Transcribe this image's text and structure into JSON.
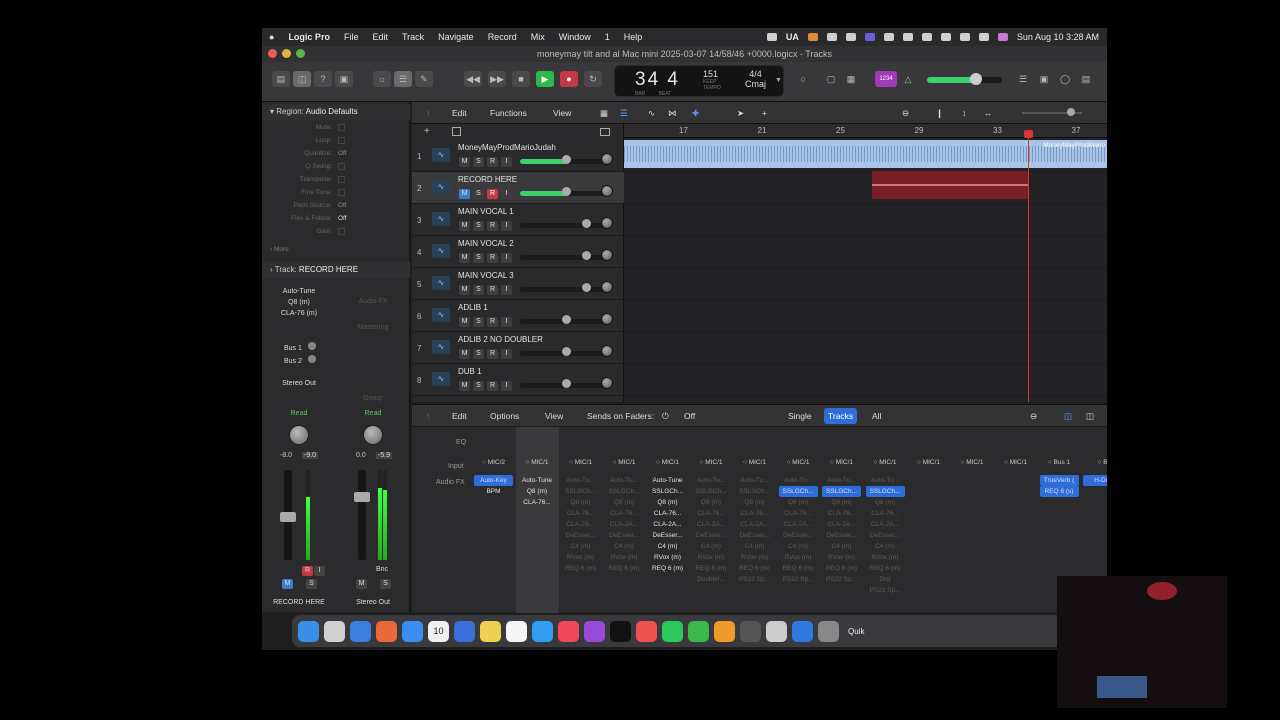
{
  "menubar": {
    "app": "Logic Pro",
    "items": [
      "File",
      "Edit",
      "Track",
      "Navigate",
      "Record",
      "Mix",
      "Window",
      "1",
      "Help"
    ],
    "ua_label": "UA",
    "datetime": "Sun Aug 10  3:28 AM"
  },
  "window_title": "moneymay tilt and al Mac mini 2025-03-07 14/58/46 +0000.logicx - Tracks",
  "lcd": {
    "bar": "34",
    "beat": "4",
    "bar_label": "BAR",
    "beat_label": "BEAT",
    "tempo": "151",
    "tempo_mode": "KEEP",
    "tempo_label": "TEMPO",
    "time_sig": "4/4",
    "key": "Cmaj"
  },
  "toolbar_badge": "1234",
  "inspector": {
    "region_header": "Region:",
    "region_name": "Audio Defaults",
    "params": [
      {
        "label": "Mute:",
        "value": ""
      },
      {
        "label": "Loop:",
        "value": ""
      },
      {
        "label": "Quantize:",
        "value": "Off"
      },
      {
        "label": "Q-Swing:",
        "value": ""
      },
      {
        "label": "Transpose:",
        "value": ""
      },
      {
        "label": "Fine Tune:",
        "value": ""
      },
      {
        "label": "Pitch Source:",
        "value": "Off"
      },
      {
        "label": "Flex & Follow:",
        "value": "Off"
      },
      {
        "label": "Gain:",
        "value": ""
      }
    ],
    "more_label": "More",
    "track_header": "Track:",
    "track_name": "RECORD HERE",
    "strip1": {
      "plugins": [
        "Auto-Tune",
        "Q8 (m)",
        "CLA-76 (m)"
      ],
      "sends": [
        "Bus 1",
        "Bus 2"
      ],
      "output": "Stereo Out",
      "automation": "Read",
      "pan": "-8.0",
      "gain": "-9.0",
      "name": "RECORD HERE"
    },
    "strip2": {
      "fx": "Audio FX",
      "mastering": "Mastering",
      "group": "Group",
      "automation": "Read",
      "pan": "0.0",
      "gain": "-5.9",
      "bnc": "Bnc",
      "name": "Stereo Out"
    }
  },
  "arrange": {
    "toolbar": {
      "edit": "Edit",
      "functions": "Functions",
      "view": "View"
    },
    "ruler": [
      "17",
      "21",
      "25",
      "29",
      "33",
      "37"
    ],
    "tracks": [
      {
        "num": "1",
        "name": "MoneyMayProdMarioJudah",
        "rec": false
      },
      {
        "num": "2",
        "name": "RECORD HERE",
        "rec": true
      },
      {
        "num": "3",
        "name": "MAIN VOCAL 1",
        "rec": false
      },
      {
        "num": "4",
        "name": "MAIN VOCAL 2",
        "rec": false
      },
      {
        "num": "5",
        "name": "MAIN VOCAL 3",
        "rec": false
      },
      {
        "num": "6",
        "name": "ADLIB 1",
        "rec": false
      },
      {
        "num": "7",
        "name": "ADLIB 2 NO DOUBLER",
        "rec": false
      },
      {
        "num": "8",
        "name": "DUB 1",
        "rec": false
      }
    ],
    "region1_name": "MoneyMayProdMario"
  },
  "mixer": {
    "toolbar": {
      "edit": "Edit",
      "options": "Options",
      "view": "View",
      "sends_label": "Sends on Faders:",
      "sends_value": "Off",
      "single": "Single",
      "tracks": "Tracks",
      "all": "All"
    },
    "row_labels": {
      "eq": "EQ",
      "input": "Input",
      "fx": "Audio FX"
    },
    "channels": [
      {
        "input": "MIC/2",
        "fx": [
          {
            "n": "Auto-Key",
            "s": "sel"
          },
          {
            "n": "BPM",
            "s": "on"
          }
        ]
      },
      {
        "input": "MIC/1",
        "fx": [
          {
            "n": "Auto-Tune",
            "s": "on"
          },
          {
            "n": "Q8 (m)",
            "s": "on"
          },
          {
            "n": "CLA-76...",
            "s": "on"
          }
        ]
      },
      {
        "input": "MIC/1",
        "fx": [
          {
            "n": "Auto-Tu...",
            "s": "off"
          },
          {
            "n": "SSLGCh...",
            "s": "off"
          },
          {
            "n": "Q8 (m)",
            "s": "off"
          },
          {
            "n": "CLA-76...",
            "s": "off"
          },
          {
            "n": "CLA-2A...",
            "s": "off"
          },
          {
            "n": "DeEsser...",
            "s": "off"
          },
          {
            "n": "C4 (m)",
            "s": "off"
          },
          {
            "n": "RVox (m)",
            "s": "off"
          },
          {
            "n": "REQ 6 (m)",
            "s": "off"
          }
        ]
      },
      {
        "input": "MIC/1",
        "fx": [
          {
            "n": "Auto-Tu...",
            "s": "off"
          },
          {
            "n": "SSLGCh...",
            "s": "off"
          },
          {
            "n": "Q8 (m)",
            "s": "off"
          },
          {
            "n": "CLA-76...",
            "s": "off"
          },
          {
            "n": "CLA-2A...",
            "s": "off"
          },
          {
            "n": "DeEsser...",
            "s": "off"
          },
          {
            "n": "C4 (m)",
            "s": "off"
          },
          {
            "n": "RVox (m)",
            "s": "off"
          },
          {
            "n": "REQ 6 (m)",
            "s": "off"
          }
        ]
      },
      {
        "input": "MIC/1",
        "fx": [
          {
            "n": "Auto-Tune",
            "s": "on"
          },
          {
            "n": "SSLGCh...",
            "s": "on"
          },
          {
            "n": "Q8 (m)",
            "s": "on"
          },
          {
            "n": "CLA-76...",
            "s": "on"
          },
          {
            "n": "CLA-2A...",
            "s": "on"
          },
          {
            "n": "DeEsser...",
            "s": "on"
          },
          {
            "n": "C4 (m)",
            "s": "on"
          },
          {
            "n": "RVox (m)",
            "s": "on"
          },
          {
            "n": "REQ 6 (m)",
            "s": "on"
          }
        ]
      },
      {
        "input": "MIC/1",
        "fx": [
          {
            "n": "Auto-Tu...",
            "s": "off"
          },
          {
            "n": "SSLGCh...",
            "s": "off"
          },
          {
            "n": "Q8 (m)",
            "s": "off"
          },
          {
            "n": "CLA-76...",
            "s": "off"
          },
          {
            "n": "CLA-2A...",
            "s": "off"
          },
          {
            "n": "DeEsser...",
            "s": "off"
          },
          {
            "n": "C4 (m)",
            "s": "off"
          },
          {
            "n": "RVox (m)",
            "s": "off"
          },
          {
            "n": "REQ 6 (m)",
            "s": "off"
          },
          {
            "n": "Doubler...",
            "s": "off"
          }
        ]
      },
      {
        "input": "MIC/1",
        "fx": [
          {
            "n": "Auto-Tu...",
            "s": "off"
          },
          {
            "n": "SSLGCh...",
            "s": "off"
          },
          {
            "n": "Q8 (m)",
            "s": "off"
          },
          {
            "n": "CLA-76...",
            "s": "off"
          },
          {
            "n": "CLA-2A...",
            "s": "off"
          },
          {
            "n": "DeEsser...",
            "s": "off"
          },
          {
            "n": "C4 (m)",
            "s": "off"
          },
          {
            "n": "RVox (m)",
            "s": "off"
          },
          {
            "n": "REQ 6 (m)",
            "s": "off"
          },
          {
            "n": "PS22 Sp...",
            "s": "off"
          }
        ]
      },
      {
        "input": "MIC/1",
        "fx": [
          {
            "n": "Auto-Tu...",
            "s": "off"
          },
          {
            "n": "SSLGCh...",
            "s": "sel"
          },
          {
            "n": "Q8 (m)",
            "s": "off"
          },
          {
            "n": "CLA-76...",
            "s": "off"
          },
          {
            "n": "CLA-2A...",
            "s": "off"
          },
          {
            "n": "DeEsser...",
            "s": "off"
          },
          {
            "n": "C4 (m)",
            "s": "off"
          },
          {
            "n": "RVox (m)",
            "s": "off"
          },
          {
            "n": "REQ 6 (m)",
            "s": "off"
          },
          {
            "n": "PS22 Sp...",
            "s": "off"
          }
        ]
      },
      {
        "input": "MIC/1",
        "fx": [
          {
            "n": "Auto-Tu...",
            "s": "off"
          },
          {
            "n": "SSLGCh...",
            "s": "sel"
          },
          {
            "n": "Q8 (m)",
            "s": "off"
          },
          {
            "n": "CLA-76...",
            "s": "off"
          },
          {
            "n": "CLA-2A...",
            "s": "off"
          },
          {
            "n": "DeEsser...",
            "s": "off"
          },
          {
            "n": "C4 (m)",
            "s": "off"
          },
          {
            "n": "RVox (m)",
            "s": "off"
          },
          {
            "n": "REQ 6 (m)",
            "s": "off"
          },
          {
            "n": "PS22 Sp...",
            "s": "off"
          }
        ]
      },
      {
        "input": "MIC/1",
        "fx": [
          {
            "n": "Auto-Tu...",
            "s": "off"
          },
          {
            "n": "SSLGCh...",
            "s": "sel"
          },
          {
            "n": "Q8 (m)",
            "s": "off"
          },
          {
            "n": "CLA-76...",
            "s": "off"
          },
          {
            "n": "CLA-2A...",
            "s": "off"
          },
          {
            "n": "DeEsser...",
            "s": "off"
          },
          {
            "n": "C4 (m)",
            "s": "off"
          },
          {
            "n": "RVox (m)",
            "s": "off"
          },
          {
            "n": "REQ 6 (m)",
            "s": "off"
          },
          {
            "n": "Dist",
            "s": "off"
          },
          {
            "n": "PS22 Sp...",
            "s": "off"
          }
        ]
      },
      {
        "input": "MIC/1",
        "fx": []
      },
      {
        "input": "MIC/1",
        "fx": []
      },
      {
        "input": "MIC/1",
        "fx": []
      },
      {
        "input": "Bus 1",
        "fx": [
          {
            "n": "TrueVerb (",
            "s": "sel"
          },
          {
            "n": "REQ 6 (s)",
            "s": "sel"
          }
        ]
      },
      {
        "input": "B",
        "fx": [
          {
            "n": "H-Del",
            "s": "sel"
          }
        ]
      }
    ]
  },
  "dock": {
    "date_num": "10",
    "quik": "Quik",
    "apps": [
      "finder-icon",
      "launchpad-icon",
      "mail-icon",
      "photos-icon",
      "appstore-icon",
      "calendar-icon",
      "keynote-icon",
      "notes-icon",
      "reminders-icon",
      "safari-icon",
      "music-icon",
      "podcasts-icon",
      "tv-icon",
      "news-icon",
      "spotify-icon",
      "numbers-icon",
      "pages-icon",
      "logic-icon",
      "script-icon",
      "xcode-icon",
      "settings-icon"
    ]
  },
  "colors": {
    "rec_red": "#c43a44",
    "accent_blue": "#2f6ed8",
    "play_green": "#2db84b",
    "region_blue": "#a8c4e6",
    "region_red": "#7a1f25"
  }
}
